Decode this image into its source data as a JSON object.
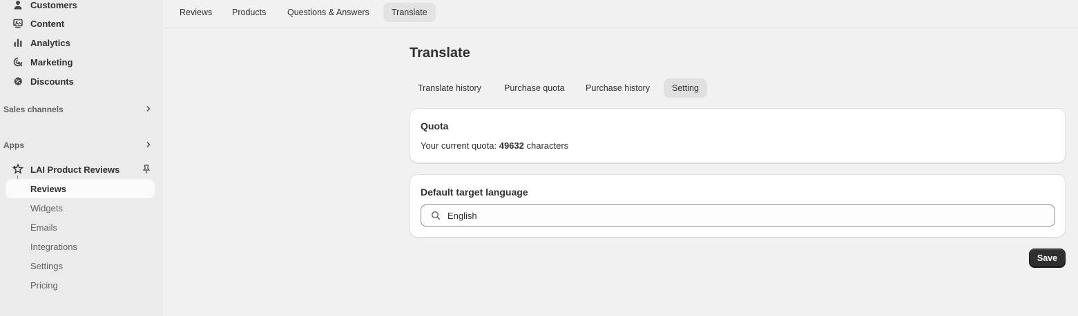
{
  "sidebar": {
    "nav_items": [
      {
        "label": "Customers",
        "icon": "person-icon"
      },
      {
        "label": "Content",
        "icon": "content-icon"
      },
      {
        "label": "Analytics",
        "icon": "bar-chart-icon"
      },
      {
        "label": "Marketing",
        "icon": "target-icon"
      },
      {
        "label": "Discounts",
        "icon": "discount-icon"
      }
    ],
    "sales_channels_label": "Sales channels",
    "apps_label": "Apps",
    "app": {
      "name": "LAI Product Reviews",
      "sub_items": [
        "Reviews",
        "Widgets",
        "Emails",
        "Integrations",
        "Settings",
        "Pricing"
      ],
      "active_sub_item": "Reviews"
    }
  },
  "top_tabs": [
    "Reviews",
    "Products",
    "Questions & Answers",
    "Translate"
  ],
  "active_top_tab": "Translate",
  "page": {
    "title": "Translate",
    "sub_tabs": [
      "Translate history",
      "Purchase quota",
      "Purchase history",
      "Setting"
    ],
    "active_sub_tab": "Setting",
    "quota_card": {
      "title": "Quota",
      "prefix": "Your current quota: ",
      "value": "49632",
      "suffix": " characters"
    },
    "language_card": {
      "title": "Default target language",
      "value": "English",
      "placeholder": ""
    },
    "save_label": "Save"
  },
  "colors": {
    "accent": "#303030",
    "background": "#f1f1f1",
    "sidebar": "#ebebeb",
    "card": "#ffffff"
  }
}
